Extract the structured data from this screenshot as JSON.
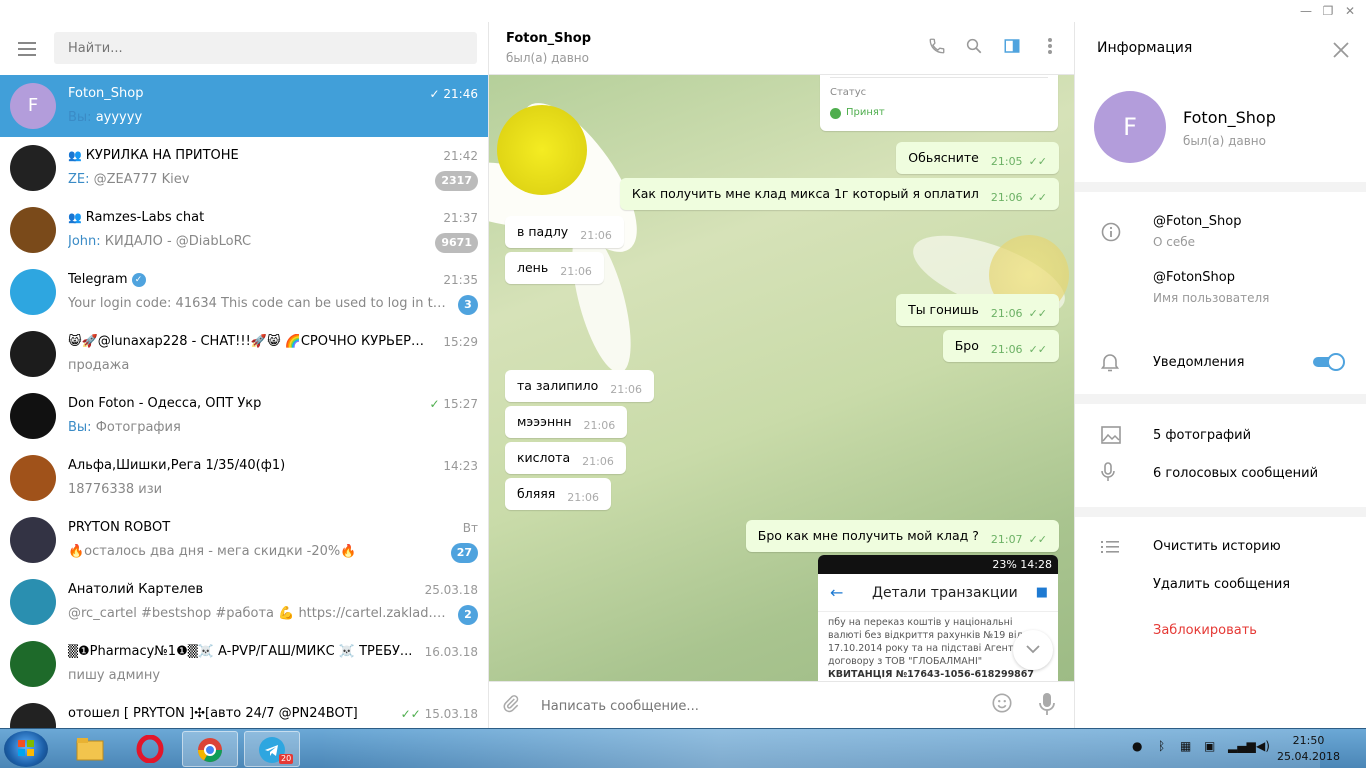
{
  "window": {
    "minimize": "—",
    "restore": "❐",
    "close": "✕"
  },
  "sidebar": {
    "search_placeholder": "Найти...",
    "dialogs": [
      {
        "name": "Foton_Shop",
        "time": "21:46",
        "sender": "Вы:",
        "msg": "ayyyyy",
        "avatar_letter": "F",
        "avatar_color": "#b39ddb",
        "active": true,
        "check": "✓"
      },
      {
        "name": "КУРИЛКА НА ПРИТОНЕ",
        "group": true,
        "time": "21:42",
        "sender": "ZE:",
        "msg": "@ZEA777 Kiev",
        "badge": "2317",
        "muted": true,
        "avatar_color": "#222"
      },
      {
        "name": "Ramzes-Labs chat",
        "group": true,
        "time": "21:37",
        "sender": "John:",
        "msg": "КИДАЛО - @DiabLoRC",
        "badge": "9671",
        "muted": true,
        "avatar_color": "#7a4a1a"
      },
      {
        "name": "Telegram",
        "verified": true,
        "time": "21:35",
        "msg": "Your login code: 41634  This code can be used to log in to your T...",
        "badge": "3",
        "avatar_color": "#2ea6e0"
      },
      {
        "name": "😸🚀@lunaxap228 - CHAT!!!🚀😸 🌈СРОЧНО КУРЬЕРЫ...",
        "time": "15:29",
        "msg": "продажа",
        "avatar_color": "#1c1c1c"
      },
      {
        "name": "Don Foton - Одесса, ОПТ Укр",
        "time": "15:27",
        "sender": "Вы:",
        "msg": "Фотография",
        "check": "✓",
        "avatar_color": "#111"
      },
      {
        "name": "Альфа,Шишки,Рега 1/35/40(ф1)",
        "time": "14:23",
        "msg": "18776338 изи",
        "avatar_color": "#a0521a"
      },
      {
        "name": "PRYTON ROBOT",
        "time": "Вт",
        "msg": "🔥осталось два дня - мега скидки -20%🔥",
        "badge": "27",
        "avatar_color": "#334"
      },
      {
        "name": "Анатолий Картелев",
        "time": "25.03.18",
        "msg": "@rc_cartel #bestshop #работа 💪 https://cartel.zaklad.cc сайт ...",
        "badge": "2",
        "avatar_color": "#2a8fb0"
      },
      {
        "name": "▒❶Pharmacy№1❶▒☠️ A-PVP/ГАШ/МИКС ☠️ ТРЕБУ...",
        "time": "16.03.18",
        "msg": "пишу админу",
        "avatar_color": "#1e6a2a"
      },
      {
        "name": "отошел [ PRYTON ]✣[авто 24/7 @PN24BOT]",
        "time": "15.03.18",
        "msg": "",
        "check": "✓✓",
        "avatar_color": "#222"
      }
    ]
  },
  "chat": {
    "title": "Foton_Shop",
    "status": "был(а) давно",
    "card_label": "Статус",
    "card_value": "Принят",
    "messages": [
      {
        "dir": "out",
        "text": "Обьясните",
        "time": "21:05"
      },
      {
        "dir": "out",
        "text": "Как получить мне клад микса 1г который я оплатил",
        "time": "21:06"
      },
      {
        "dir": "in",
        "text": "в падлу",
        "time": "21:06"
      },
      {
        "dir": "in",
        "text": "лень",
        "time": "21:06"
      },
      {
        "dir": "out",
        "text": "Ты гонишь",
        "time": "21:06"
      },
      {
        "dir": "out",
        "text": "Бро",
        "time": "21:06"
      },
      {
        "dir": "in",
        "text": "та залипило",
        "time": "21:06"
      },
      {
        "dir": "in",
        "text": "мэээннн",
        "time": "21:06"
      },
      {
        "dir": "in",
        "text": "кислота",
        "time": "21:06"
      },
      {
        "dir": "in",
        "text": "бляяя",
        "time": "21:06"
      },
      {
        "dir": "out",
        "text": "Бро как мне получить мой клад ?",
        "time": "21:07"
      }
    ],
    "checks": "✓✓",
    "phone": {
      "statusbar": "23%  14:28",
      "title": "Детали транзакции",
      "line1": "пбу на переказ коштів у національні",
      "line2": "валюті без відкриття рахунків №19 від",
      "line3": "17.10.2014 року та на підставі Агентс",
      "line4": "договору з ТОВ \"ГЛОБАЛМАНІ\"",
      "line5": "КВИТАНЦІЯ №17643-1056-618299867"
    },
    "composer_placeholder": "Написать сообщение..."
  },
  "info": {
    "title": "Информация",
    "name": "Foton_Shop",
    "status": "был(а) давно",
    "avatar_letter": "F",
    "about_value": "@Foton_Shop",
    "about_label": "О себе",
    "username_value": "@FotonShop",
    "username_label": "Имя пользователя",
    "notifications": "Уведомления",
    "notifications_on": true,
    "photos": "5 фотографий",
    "voice": "6 голосовых сообщений",
    "clear": "Очистить историю",
    "delete": "Удалить сообщения",
    "block": "Заблокировать"
  },
  "taskbar": {
    "time": "21:50",
    "date": "25.04.2018",
    "telegram_badge": "20"
  }
}
